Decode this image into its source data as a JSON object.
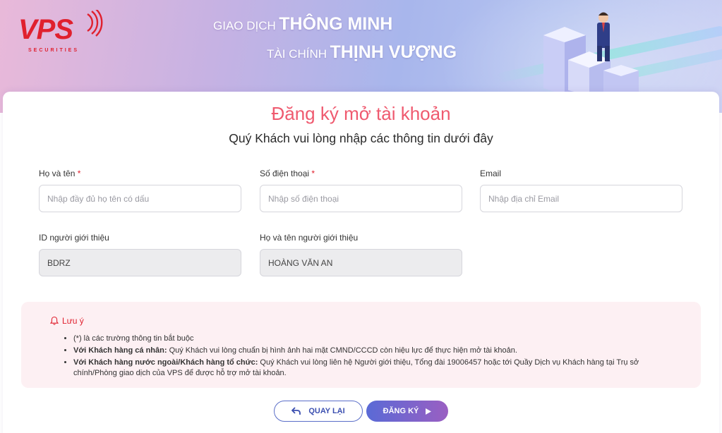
{
  "banner": {
    "logo_text": "VPS",
    "logo_sub": "SECURITIES",
    "slogan_line1_small": "GIAO DỊCH",
    "slogan_line1_big": "THÔNG MINH",
    "slogan_line2_small": "TÀI CHÍNH",
    "slogan_line2_big": "THỊNH VƯỢNG"
  },
  "form": {
    "title": "Đăng ký mở tài khoản",
    "subtitle": "Quý Khách vui lòng nhập các thông tin dưới đây",
    "fields": [
      {
        "label": "Họ và tên",
        "required": "*",
        "placeholder": "Nhập đầy đủ họ tên có dấu",
        "value": ""
      },
      {
        "label": "Số điện thoại",
        "required": "*",
        "placeholder": "Nhập số điện thoại",
        "value": ""
      },
      {
        "label": "Email",
        "required": "",
        "placeholder": "Nhập địa chỉ Email",
        "value": ""
      },
      {
        "label": "ID người giới thiệu",
        "required": "",
        "placeholder": "",
        "value": "BDRZ"
      },
      {
        "label": "Họ và tên người giới thiệu",
        "required": "",
        "placeholder": "",
        "value": "HOÀNG VĂN AN"
      }
    ]
  },
  "note": {
    "title": "Lưu ý",
    "item1": "(*) là các trường thông tin bắt buộc",
    "item2_bold": "Với Khách hàng cá nhân:",
    "item2_text": " Quý Khách vui lòng chuẩn bị hình ảnh hai mặt CMND/CCCD còn hiệu lực để thực hiện mở tài khoản.",
    "item3_bold": "Với Khách hàng nước ngoài/Khách hàng tổ chức:",
    "item3_text": " Quý Khách vui lòng liên hệ Người giới thiệu, Tổng đài 19006457 hoặc tới Quầy Dịch vụ Khách hàng tại Trụ sở chính/Phòng giao dịch của VPS để được hỗ trợ mở tài khoản."
  },
  "buttons": {
    "back_label": "QUAY LẠI",
    "submit_label": "ĐĂNG KÝ"
  },
  "colors": {
    "accent": "#ef5a6f",
    "brand_red": "#e0202e",
    "button_blue": "#5a6ad6"
  },
  "icons": {
    "back": "return-arrow-icon",
    "submit": "play-triangle-icon",
    "note": "bell-icon"
  }
}
